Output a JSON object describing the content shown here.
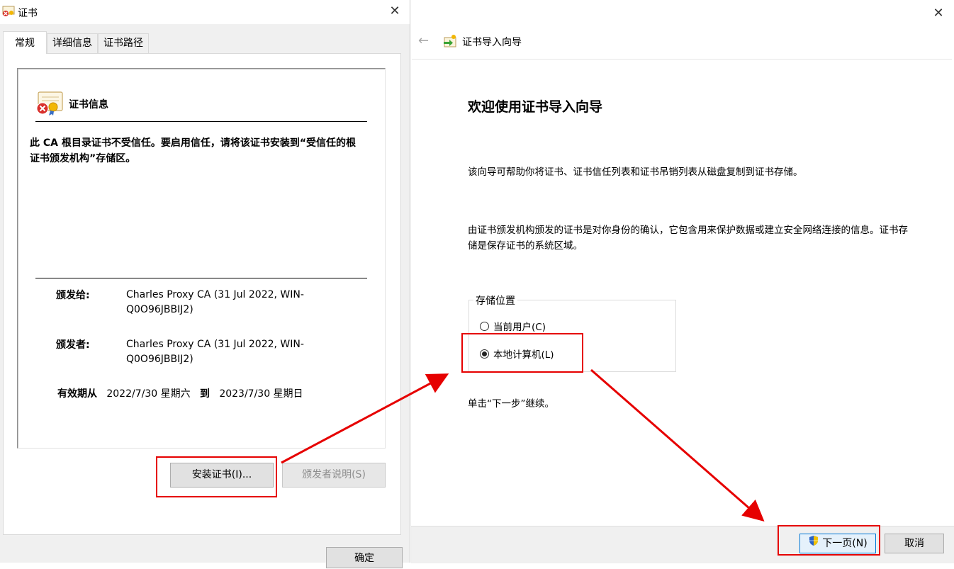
{
  "cert_dialog": {
    "title": "证书",
    "close_glyph": "✕",
    "tabs": [
      "常规",
      "详细信息",
      "证书路径"
    ],
    "info_heading": "证书信息",
    "trust_message": "此 CA 根目录证书不受信任。要启用信任，请将该证书安装到“受信任的根证书颁发机构”存储区。",
    "issued_to_label": "颁发给:",
    "issued_to_value": "Charles Proxy CA (31 Jul 2022, WIN-Q0O96JBBIJ2)",
    "issued_by_label": "颁发者:",
    "issued_by_value": "Charles Proxy CA (31 Jul 2022, WIN-Q0O96JBBIJ2)",
    "valid_from_label": "有效期从",
    "valid_from": "2022/7/30 星期六",
    "valid_to_label": "到",
    "valid_to": "2023/7/30 星期日",
    "install_button": "安装证书(I)...",
    "issuer_statement_button": "颁发者说明(S)",
    "ok_button": "确定"
  },
  "wizard": {
    "close_glyph": "✕",
    "back_glyph": "←",
    "header_title": "证书导入向导",
    "welcome_heading": "欢迎使用证书导入向导",
    "intro_text": "该向导可帮助你将证书、证书信任列表和证书吊销列表从磁盘复制到证书存储。",
    "cert_description": "由证书颁发机构颁发的证书是对你身份的确认，它包含用来保护数据或建立安全网络连接的信息。证书存储是保存证书的系统区域。",
    "store_location_legend": "存储位置",
    "options": [
      {
        "label": "当前用户(C)",
        "checked": false
      },
      {
        "label": "本地计算机(L)",
        "checked": true
      }
    ],
    "continue_hint": "单击“下一步”继续。",
    "next_button": "下一页(N)",
    "cancel_button": "取消"
  },
  "annotation_color": "#e60000"
}
